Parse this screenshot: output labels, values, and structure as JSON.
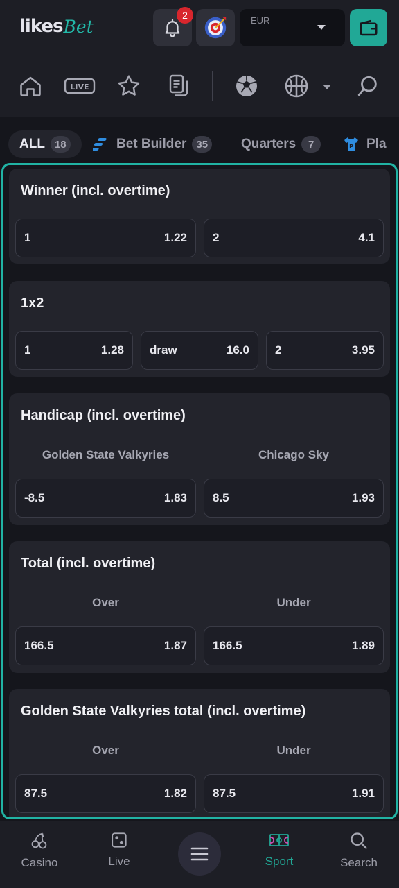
{
  "header": {
    "logo_part1": "likes",
    "logo_part2": "Bet",
    "notification_count": "2",
    "currency_label": "EUR"
  },
  "sport_nav": {
    "icons": [
      "home-icon",
      "live-icon",
      "star-icon",
      "betslip-icon",
      "football-icon",
      "basketball-icon",
      "chevron-down-icon",
      "search-icon"
    ],
    "live_text": "LIVE"
  },
  "filters": {
    "tabs": [
      {
        "label": "ALL",
        "count": "18",
        "active": true
      },
      {
        "label": "Bet Builder",
        "count": "35",
        "icon": "bet-builder-icon"
      },
      {
        "label": "Quarters",
        "count": "7"
      },
      {
        "label": "Pla",
        "icon": "jersey-icon"
      }
    ]
  },
  "markets": [
    {
      "title": "Winner (incl. overtime)",
      "odds": [
        {
          "label": "1",
          "value": "1.22"
        },
        {
          "label": "2",
          "value": "4.1"
        }
      ]
    },
    {
      "title": "1x2",
      "odds": [
        {
          "label": "1",
          "value": "1.28"
        },
        {
          "label": "draw",
          "value": "16.0"
        },
        {
          "label": "2",
          "value": "3.95"
        }
      ]
    },
    {
      "title": "Handicap (incl. overtime)",
      "columns": [
        "Golden State Valkyries",
        "Chicago Sky"
      ],
      "odds": [
        {
          "label": "-8.5",
          "value": "1.83"
        },
        {
          "label": "8.5",
          "value": "1.93"
        }
      ]
    },
    {
      "title": "Total (incl. overtime)",
      "columns": [
        "Over",
        "Under"
      ],
      "odds": [
        {
          "label": "166.5",
          "value": "1.87"
        },
        {
          "label": "166.5",
          "value": "1.89"
        }
      ]
    },
    {
      "title": "Golden State Valkyries total (incl. overtime)",
      "columns": [
        "Over",
        "Under"
      ],
      "odds": [
        {
          "label": "87.5",
          "value": "1.82"
        },
        {
          "label": "87.5",
          "value": "1.91"
        }
      ]
    }
  ],
  "bottom_nav": {
    "items": [
      {
        "label": "Casino",
        "icon": "cherries-icon"
      },
      {
        "label": "Live",
        "icon": "dice-icon"
      },
      {
        "label": "Sport",
        "icon": "court-icon",
        "active": true
      },
      {
        "label": "Search",
        "icon": "search-icon"
      }
    ],
    "menu_icon": "hamburger-menu-icon"
  },
  "colors": {
    "accent": "#21b3a4",
    "badge": "#d8262d",
    "background": "#15161c",
    "card": "#23242c"
  }
}
